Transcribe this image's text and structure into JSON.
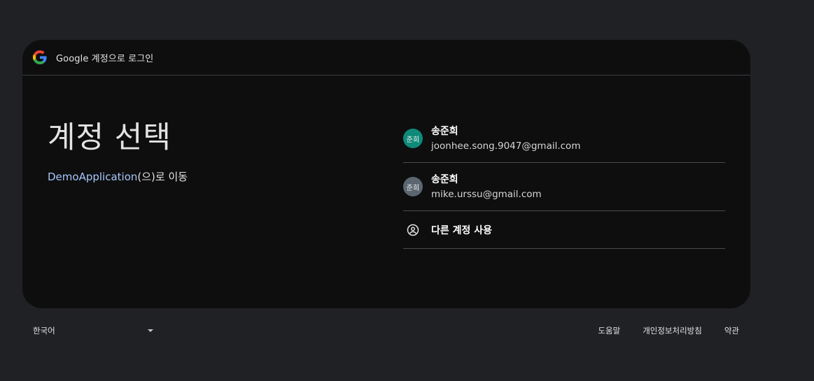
{
  "header": {
    "title": "Google 계정으로 로그인"
  },
  "main": {
    "title": "계정 선택",
    "subtitle_app": "DemoApplication",
    "subtitle_suffix": "(으)로 이동"
  },
  "accounts": [
    {
      "avatar_text": "준희",
      "avatar_color": "#0f8a78",
      "name": "송준희",
      "email": "joonhee.song.9047@gmail.com"
    },
    {
      "avatar_text": "준희",
      "avatar_color": "#5b6670",
      "name": "송준희",
      "email": "mike.urssu@gmail.com"
    }
  ],
  "other_account": {
    "label": "다른 계정 사용",
    "icon": "account-circle-icon"
  },
  "footer": {
    "language": "한국어",
    "links": [
      "도움말",
      "개인정보처리방침",
      "약관"
    ]
  },
  "colors": {
    "page_bg": "#202124",
    "card_bg": "#0e0e0f",
    "link": "#a8c7fa"
  }
}
